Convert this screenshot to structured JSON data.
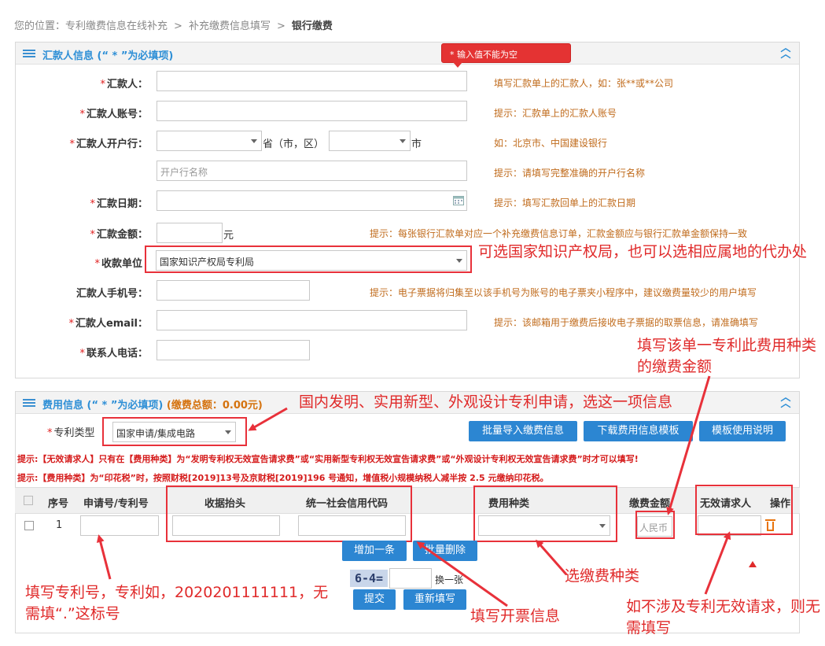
{
  "breadcrumb": {
    "prefix": "您的位置：",
    "item1": "专利缴费信息在线补充",
    "item2": "补充缴费信息填写",
    "current": "银行缴费",
    "sep": ">"
  },
  "remitter_panel": {
    "title": "汇款人信息 (“ * ”为必填项)",
    "tooltip": "* 输入值不能为空",
    "fields": {
      "remitter": {
        "label": "汇款人：",
        "hint": "填写汇款单上的汇款人，如：张**或**公司"
      },
      "account": {
        "label": "汇款人账号：",
        "hint": "提示：汇款单上的汇款人账号"
      },
      "bank": {
        "label": "汇款人开户行：",
        "province_suffix": "省（市，区）",
        "city_suffix": "市",
        "hint": "如：北京市、中国建设银行",
        "name_placeholder": "开户行名称",
        "name_hint": "提示：请填写完整准确的开户行名称"
      },
      "date": {
        "label": "汇款日期：",
        "hint": "提示：填写汇款回单上的汇款日期"
      },
      "amount": {
        "label": "汇款金额：",
        "unit": "元",
        "hint": "提示：每张银行汇款单对应一个补充缴费信息订单，汇款金额应与银行汇款单金额保持一致"
      },
      "payee": {
        "label": "收款单位",
        "value": "国家知识产权局专利局"
      },
      "phone": {
        "label": "汇款人手机号：",
        "hint": "提示：电子票据将归集至以该手机号为账号的电子票夹小程序中，建议缴费量较少的用户填写"
      },
      "email": {
        "label": "汇款人email：",
        "hint": "提示：该邮箱用于缴费后接收电子票据的取票信息，请准确填写"
      },
      "contact": {
        "label": "联系人电话："
      }
    }
  },
  "fee_panel": {
    "title": "费用信息 (“ * ”为必填项)",
    "total": "(缴费总额：0.00元)",
    "patent_type_label": "专利类型",
    "patent_type_value": "国家申请/集成电路",
    "buttons": {
      "import": "批量导入缴费信息",
      "download": "下载费用信息模板",
      "guide": "模板使用说明",
      "add": "增加一条",
      "batch_delete": "批量删除",
      "submit": "提交",
      "reset": "重新填写",
      "refresh_captcha": "换一张"
    },
    "warning1": "提示:【无效请求人】只有在【费用种类】为“发明专利权无效宣告请求费”或“实用新型专利权无效宣告请求费”或“外观设计专利权无效宣告请求费”时才可以填写!",
    "warning2": "提示:【费用种类】为“印花税”时，按照财税[2019]13号及京财税[2019]196 号通知，增值税小规模纳税人减半按 2.5 元缴纳印花税。",
    "table": {
      "headers": [
        "序号",
        "申请号/专利号",
        "收据抬头",
        "统一社会信用代码",
        "费用种类",
        "缴费金额",
        "无效请求人",
        "操作"
      ],
      "row": {
        "index": "1",
        "amount_placeholder": "人民币"
      }
    },
    "captcha_text": "6-4="
  },
  "annotations": {
    "payee_note": "可选国家知识产权局，也可以选相应属地的代办处",
    "patent_type_note": "国内发明、实用新型、外观设计专利申请，选这一项信息",
    "amount_note": "填写该单一专利此费用种类的缴费金额",
    "patent_no_note": "填写专利号，专利如，2020201111111，无需填“.”这标号",
    "invoice_note": "填写开票信息",
    "fee_type_note": "选缴费种类",
    "invalid_note": "如不涉及专利无效请求，则无需填写"
  },
  "colors": {
    "accent": "#2c86d2",
    "annotation_red": "#e02a2a",
    "hint_orange": "#c06b1c"
  }
}
